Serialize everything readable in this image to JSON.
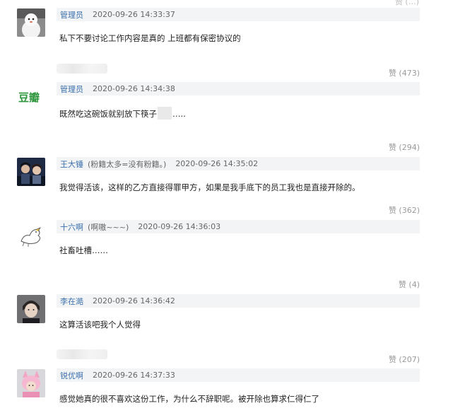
{
  "top_likes": "赞 (…)",
  "comments": [
    {
      "author": "管理员",
      "nick": "",
      "time": "2020-09-26 14:33:37",
      "text": "私下不要讨论工作内容是真的 上班都有保密协议的",
      "likes": "",
      "avatar": "snowman-avatar"
    },
    {
      "author": "管理员",
      "nick": "",
      "time": "2020-09-26 14:34:38",
      "text_before": "既然吃这碗饭就别放下筷子",
      "text_after": "…..",
      "likes": "赞 (473)",
      "avatar": "douban-logo",
      "avatar_text": "豆瓣"
    },
    {
      "author": "王大锤",
      "nick": "(粉籍太多=没有粉籍。)",
      "time": "2020-09-26 14:35:02",
      "text": "我觉得活该，这样的乙方直接得罪甲方，如果是我手底下的员工我也是直接开除的。",
      "likes": "赞 (294)",
      "avatar": "couple-photo-avatar"
    },
    {
      "author": "十六啊",
      "nick": "(啊嗷~~~)",
      "time": "2020-09-26 14:36:03",
      "text": "社畜吐槽……",
      "likes": "赞 (362)",
      "avatar": "duck-sketch-avatar"
    },
    {
      "author": "李在澔",
      "nick": "",
      "time": "2020-09-26 14:36:42",
      "text": "这算活该吧我个人觉得",
      "likes": "赞 (4)",
      "avatar": "portrait-avatar"
    },
    {
      "author": "锐优啊",
      "nick": "",
      "time": "2020-09-26 14:37:33",
      "text": "感觉她真的很不喜欢这份工作，为什么不辞职呢。被开除也算求仁得仁了",
      "likes": "赞 (207)",
      "avatar": "pink-costume-avatar"
    }
  ]
}
